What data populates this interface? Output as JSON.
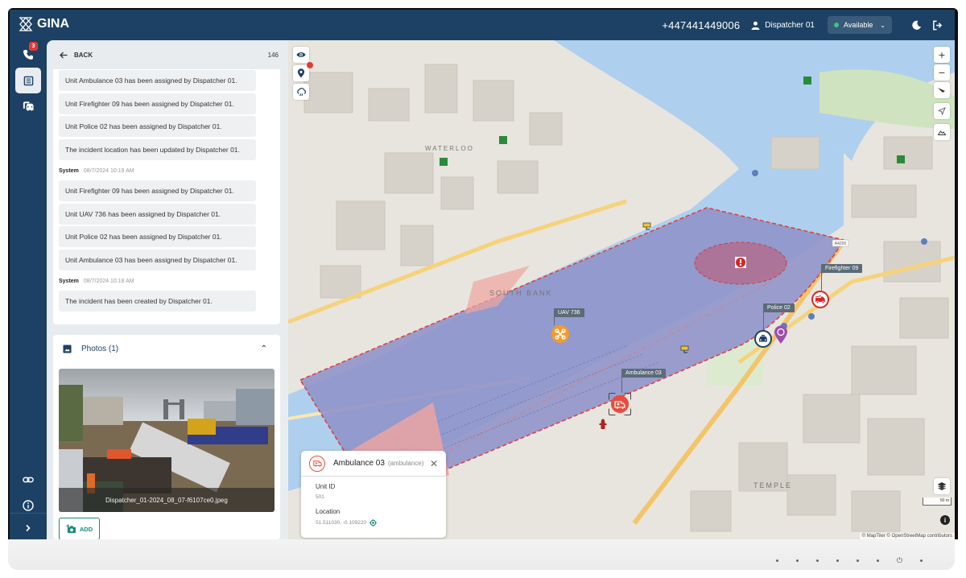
{
  "app": {
    "name": "GINA",
    "phone_number": "+447441449006",
    "user": "Dispatcher 01",
    "status": {
      "label": "Available",
      "color": "#3cc47c"
    },
    "brand_color": "#1d4164",
    "accent_color": "#1b8a7a"
  },
  "sidebar": {
    "items": [
      {
        "name": "calls",
        "icon": "phone-icon",
        "badge": "3"
      },
      {
        "name": "incidents",
        "icon": "list-icon",
        "active": true
      },
      {
        "name": "units",
        "icon": "vehicles-icon"
      },
      {
        "name": "links",
        "icon": "link-icon"
      },
      {
        "name": "info",
        "icon": "info-icon"
      },
      {
        "name": "expand",
        "icon": "chevron-right-icon"
      }
    ]
  },
  "panel": {
    "back_label": "BACK",
    "incident_number": "146",
    "log_groups": [
      {
        "items": [
          "Unit Ambulance 03 has been assigned by Dispatcher 01.",
          "Unit Firefighter 09 has been assigned by Dispatcher 01.",
          "Unit Police 02 has been assigned by Dispatcher 01.",
          "The incident location has been updated by Dispatcher 01."
        ]
      },
      {
        "author": "System",
        "timestamp": "08/7/2024 10:19 AM",
        "items": [
          "Unit Firefighter 09 has been assigned by Dispatcher 01.",
          "Unit UAV 736 has been assigned by Dispatcher 01.",
          "Unit Police 02 has been assigned by Dispatcher 01.",
          "Unit Ambulance 03 has been assigned by Dispatcher 01."
        ]
      },
      {
        "author": "System",
        "timestamp": "08/7/2024 10:18 AM",
        "items": [
          "The incident has been created by Dispatcher 01."
        ]
      }
    ],
    "photos": {
      "title": "Photos (1)",
      "files": [
        {
          "caption": "Dispatcher_01-2024_08_07-f6107ce0.jpeg"
        }
      ],
      "add_label": "ADD"
    }
  },
  "map": {
    "area_labels": [
      "SOUTH BANK",
      "WATERLOO",
      "TEMPLE"
    ],
    "units": [
      {
        "label": "UAV 736",
        "type": "uav",
        "color": "#f39c2a"
      },
      {
        "label": "Ambulance 03",
        "type": "ambulance",
        "color": "#e74c3c"
      },
      {
        "label": "Police 02",
        "type": "police",
        "color": "#1d4164"
      },
      {
        "label": "Firefighter 09",
        "type": "firefighter",
        "color": "#d62828"
      }
    ],
    "road_label": "A4200",
    "scale_label": "50 m",
    "attribution": "© MapTiler © OpenStreetMap contributors",
    "popup": {
      "name": "Ambulance 03",
      "type": "(ambulance)",
      "unit_id_label": "Unit ID",
      "unit_id": "501",
      "location_label": "Location",
      "location": "51.511030, -0.109220"
    }
  }
}
